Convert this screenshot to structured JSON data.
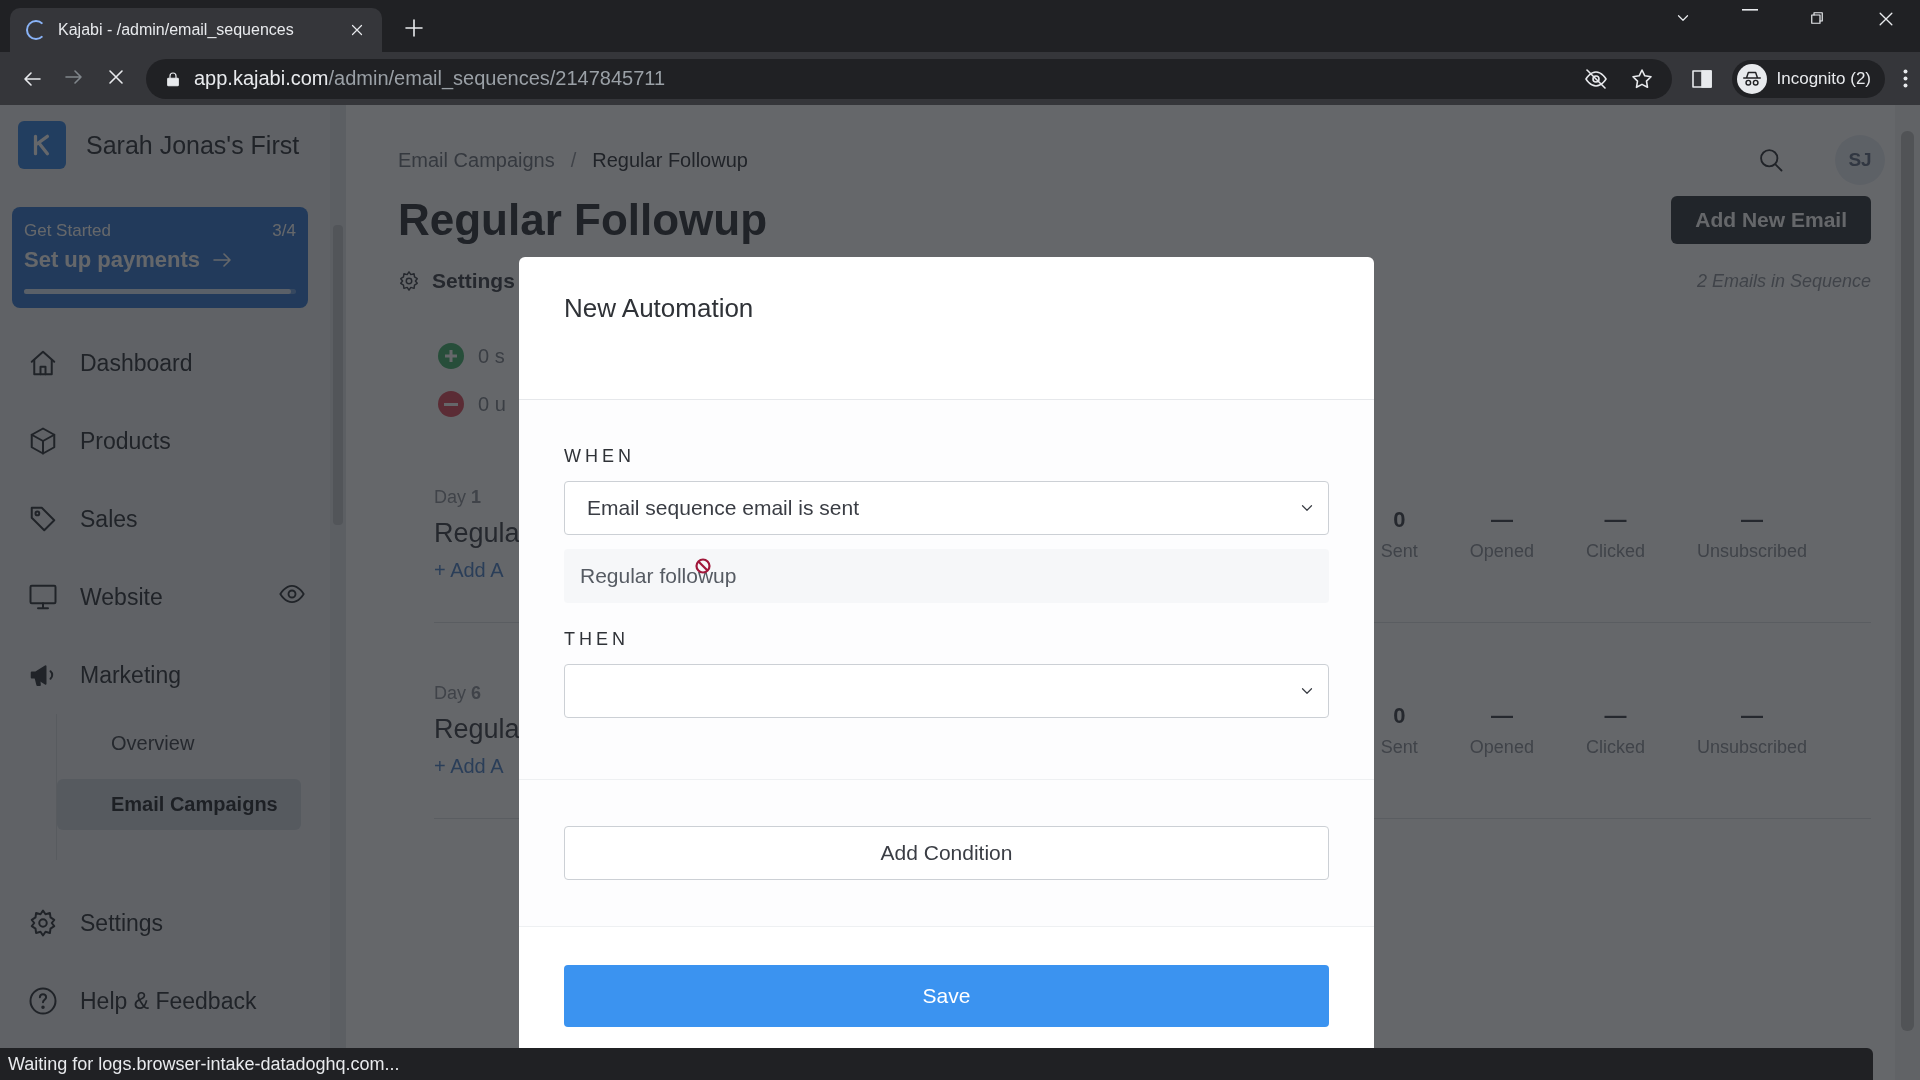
{
  "browser": {
    "tab": {
      "title": "Kajabi - /admin/email_sequences",
      "loading": true
    },
    "address": {
      "domain": "app.kajabi.com",
      "path": "/admin/email_sequences/2147845711",
      "loading": true
    },
    "profile": "Incognito (2)"
  },
  "sidebar": {
    "site_name": "Sarah Jonas's First",
    "get_started": {
      "label": "Get Started",
      "count": "3/4",
      "action": "Set up payments",
      "level": 0.98
    },
    "nav": [
      {
        "label": "Dashboard"
      },
      {
        "label": "Products"
      },
      {
        "label": "Sales"
      },
      {
        "label": "Website"
      },
      {
        "label": "Marketing",
        "expanded": true,
        "children": [
          {
            "label": "Overview",
            "selected": false
          },
          {
            "label": "Email Campaigns",
            "selected": true
          }
        ]
      }
    ],
    "footer_nav": [
      {
        "label": "Settings"
      },
      {
        "label": "Help & Feedback"
      }
    ]
  },
  "page": {
    "breadcrumb": [
      "Email Campaigns",
      "Regular Followup"
    ],
    "breadcrumb_separator": "/",
    "avatar": "SJ",
    "title": "Regular Followup",
    "add_button": "Add New Email",
    "settings": "Settings",
    "email_count": "2 Emails in Sequence",
    "subscriber_stats": [
      {
        "kind": "added",
        "text": "0 s"
      },
      {
        "kind": "removed",
        "text": "0 u"
      }
    ],
    "emails": [
      {
        "day": "Day **1**",
        "title": "Regula",
        "add": "+ Add A",
        "stats": [
          {
            "value": "0",
            "label": "Sent"
          },
          {
            "value": "—",
            "label": "Opened"
          },
          {
            "value": "—",
            "label": "Clicked"
          },
          {
            "value": "—",
            "label": "Unsubscribed"
          }
        ]
      },
      {
        "day": "Day **6**",
        "title": "Regula",
        "add": "+ Add A",
        "stats": [
          {
            "value": "0",
            "label": "Sent"
          },
          {
            "value": "—",
            "label": "Opened"
          },
          {
            "value": "—",
            "label": "Clicked"
          },
          {
            "value": "—",
            "label": "Unsubscribed"
          }
        ]
      }
    ]
  },
  "modal": {
    "title": "New Automation",
    "when": {
      "label": "WHEN",
      "value": "Email sequence email is sent"
    },
    "source": {
      "value": "Regular followup",
      "disabled": true
    },
    "then": {
      "label": "THEN"
    },
    "add_condition": "Add Condition",
    "save": "Save"
  },
  "status_bar": "Waiting for logs.browser-intake-datadoghq.com..."
}
